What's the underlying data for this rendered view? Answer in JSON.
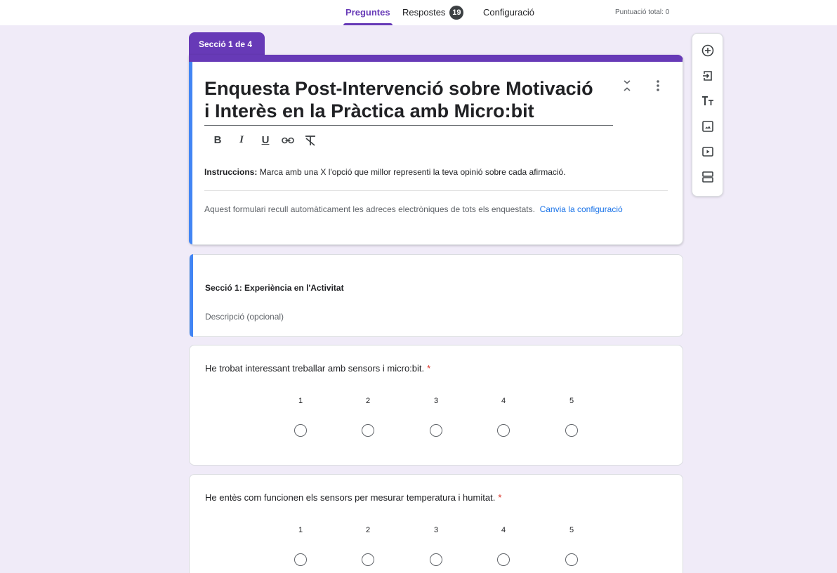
{
  "nav": {
    "tab_questions": "Preguntes",
    "tab_responses": "Respostes",
    "responses_count": "19",
    "tab_settings": "Configuració",
    "total_score": "Puntuació total: 0"
  },
  "form": {
    "section_tag": "Secció 1 de 4",
    "title_line1": "Enquesta Post-Intervenció sobre Motivació",
    "title_line2": "i Interès en la Pràctica amb Micro:bit",
    "format": {
      "bold": "B",
      "italic": "I",
      "underline": "U"
    },
    "instructions_label": "Instruccions:",
    "instructions_text": " Marca amb una X l'opció que millor representi la teva opinió sobre cada afirmació.",
    "email_note": "Aquest formulari recull automàticament les adreces electròniques de tots els enquestats.",
    "email_link_1": "Canvia la",
    "email_link_2": "configuració"
  },
  "section": {
    "title": "Secció 1: Experiència en l'Activitat",
    "description": "Descripció (opcional)"
  },
  "questions": [
    {
      "text": "He trobat interessant treballar amb sensors i micro:bit.",
      "required_mark": "*",
      "scale": [
        "1",
        "2",
        "3",
        "4",
        "5"
      ]
    },
    {
      "text": "He entès com funcionen els sensors per mesurar temperatura i humitat.",
      "required_mark": "*",
      "scale": [
        "1",
        "2",
        "3",
        "4",
        "5"
      ]
    }
  ],
  "toolbar": {
    "icons": [
      "add-question-icon",
      "import-questions-icon",
      "add-title-icon",
      "add-image-icon",
      "add-video-icon",
      "add-section-icon"
    ]
  },
  "colors": {
    "accent": "#673ab7",
    "focus": "#4285f4",
    "background": "#f0ebf8",
    "required": "#d93025",
    "link": "#1a73e8"
  }
}
